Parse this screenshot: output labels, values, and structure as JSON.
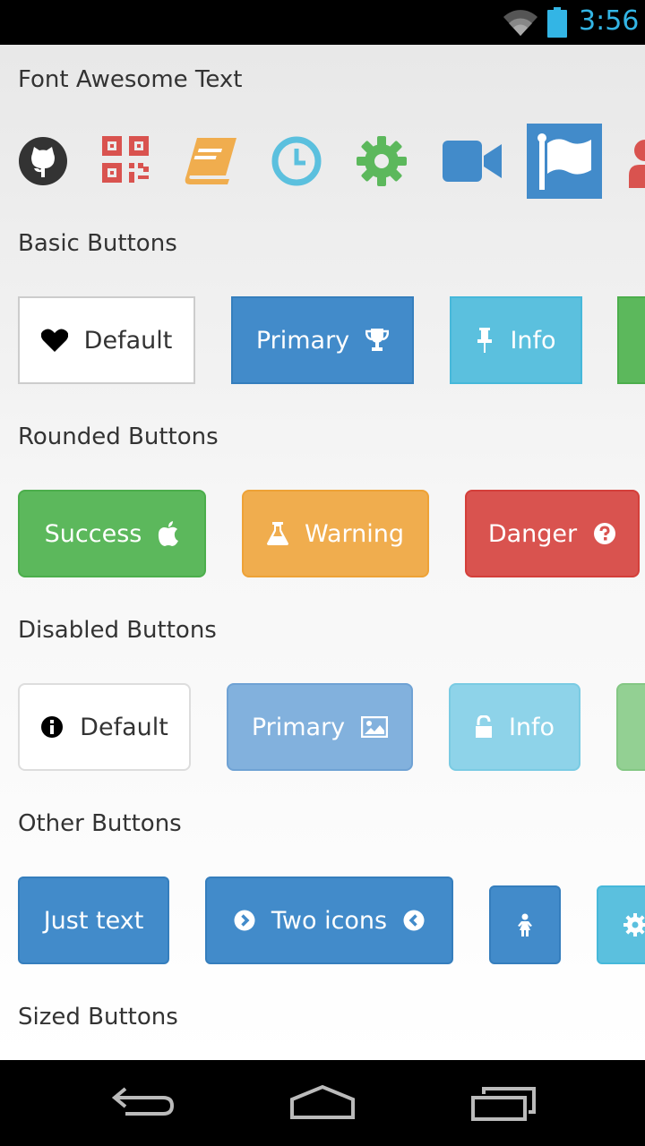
{
  "status_bar": {
    "time": "3:56",
    "accent": "#33b5e5"
  },
  "sections": {
    "font_awesome_text": "Font Awesome Text",
    "basic_buttons": "Basic Buttons",
    "rounded_buttons": "Rounded Buttons",
    "disabled_buttons": "Disabled Buttons",
    "other_buttons": "Other Buttons",
    "sized_buttons": "Sized Buttons"
  },
  "icons_row": [
    {
      "name": "github-icon",
      "color": "#333333"
    },
    {
      "name": "qrcode-icon",
      "color": "#d9534f"
    },
    {
      "name": "book-icon",
      "color": "#f0ad4e"
    },
    {
      "name": "clock-icon",
      "color": "#5bc0de"
    },
    {
      "name": "gear-icon",
      "color": "#5cb85c"
    },
    {
      "name": "video-camera-icon",
      "color": "#428bca"
    },
    {
      "name": "flag-icon",
      "color": "#ffffff",
      "background": "#428bca"
    },
    {
      "name": "user-icon",
      "color": "#d9534f"
    }
  ],
  "basic_buttons": {
    "default": {
      "label": "Default",
      "icon": "heart-icon"
    },
    "primary": {
      "label": "Primary",
      "icon": "trophy-icon"
    },
    "info": {
      "label": "Info",
      "icon": "thumb-tack-icon"
    },
    "success": {
      "label": "",
      "icon": ""
    }
  },
  "rounded_buttons": {
    "success": {
      "label": "Success",
      "icon": "apple-icon"
    },
    "warning": {
      "label": "Warning",
      "icon": "flask-icon"
    },
    "danger": {
      "label": "Danger",
      "icon": "question-circle-icon"
    }
  },
  "disabled_buttons": {
    "default": {
      "label": "Default",
      "icon": "info-circle-icon"
    },
    "primary": {
      "label": "Primary",
      "icon": "picture-icon"
    },
    "info": {
      "label": "Info",
      "icon": "unlock-icon"
    },
    "success": {
      "label": "",
      "icon": ""
    }
  },
  "other_buttons": {
    "just_text": {
      "label": "Just text"
    },
    "two_icons": {
      "label": "Two icons",
      "icon_left": "chevron-circle-right-icon",
      "icon_right": "chevron-circle-left-icon"
    },
    "icon_only": {
      "icon": "female-icon"
    },
    "partial": {
      "icon": "gear-icon"
    }
  },
  "colors": {
    "primary": "#428bca",
    "info": "#5bc0de",
    "success": "#5cb85c",
    "warning": "#f0ad4e",
    "danger": "#d9534f"
  },
  "nav_bar": [
    "back-icon",
    "home-icon",
    "recent-apps-icon"
  ]
}
